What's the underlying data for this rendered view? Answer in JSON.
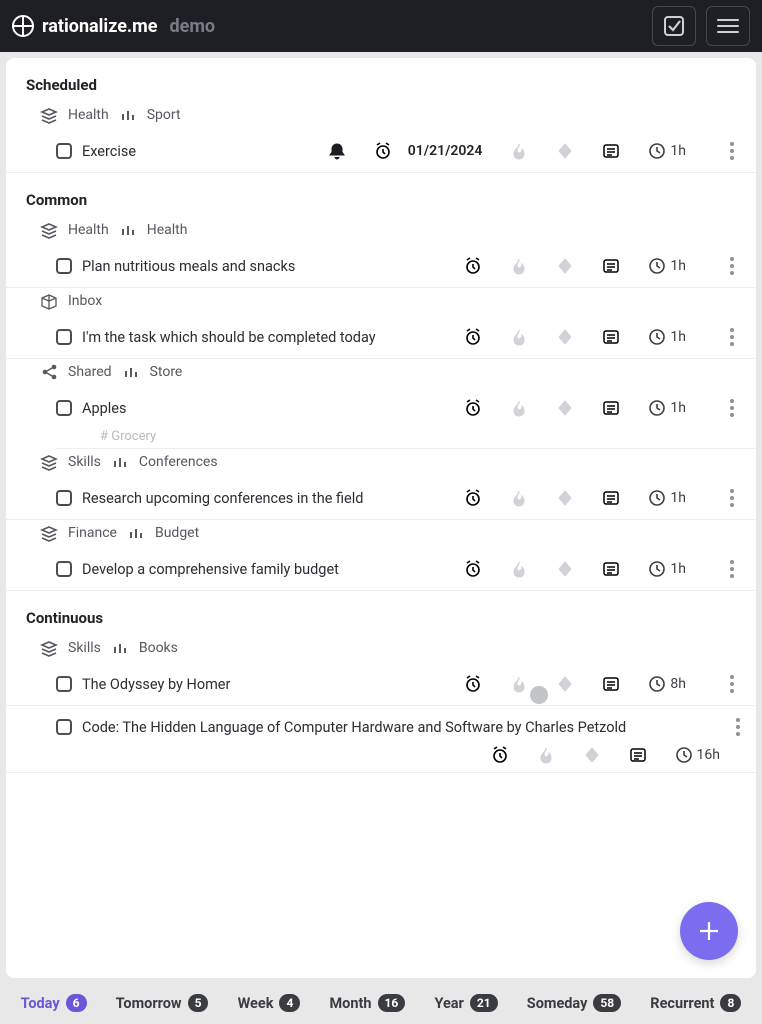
{
  "header": {
    "brand": "rationalize.me",
    "demo": "demo"
  },
  "sections": {
    "scheduled": {
      "title": "Scheduled"
    },
    "common": {
      "title": "Common"
    },
    "continuous": {
      "title": "Continuous"
    }
  },
  "breadcrumbs": {
    "health_sport": {
      "a": "Health",
      "b": "Sport"
    },
    "health_health": {
      "a": "Health",
      "b": "Health"
    },
    "inbox": {
      "a": "Inbox"
    },
    "shared_store": {
      "a": "Shared",
      "b": "Store"
    },
    "skills_conf": {
      "a": "Skills",
      "b": "Conferences"
    },
    "finance_budget": {
      "a": "Finance",
      "b": "Budget"
    },
    "skills_books": {
      "a": "Skills",
      "b": "Books"
    }
  },
  "tasks": {
    "exercise": {
      "title": "Exercise",
      "date": "01/21/2024",
      "duration": "1h"
    },
    "plan_meals": {
      "title": "Plan nutritious meals and snacks",
      "duration": "1h"
    },
    "today_task": {
      "title": "I'm the task which should be completed today",
      "duration": "1h"
    },
    "apples": {
      "title": "Apples",
      "duration": "1h",
      "tag": "# Grocery"
    },
    "research_conf": {
      "title": "Research upcoming conferences in the field",
      "duration": "1h"
    },
    "budget_task": {
      "title": "Develop a comprehensive family budget",
      "duration": "1h"
    },
    "odyssey": {
      "title": "The Odyssey by Homer",
      "duration": "8h"
    },
    "code_book": {
      "title": "Code: The Hidden Language of Computer Hardware and Software by Charles Petzold",
      "duration": "16h"
    }
  },
  "nav": {
    "today": {
      "label": "Today",
      "count": "6"
    },
    "tomorrow": {
      "label": "Tomorrow",
      "count": "5"
    },
    "week": {
      "label": "Week",
      "count": "4"
    },
    "month": {
      "label": "Month",
      "count": "16"
    },
    "year": {
      "label": "Year",
      "count": "21"
    },
    "someday": {
      "label": "Someday",
      "count": "58"
    },
    "recurrent": {
      "label": "Recurrent",
      "count": "8"
    }
  }
}
